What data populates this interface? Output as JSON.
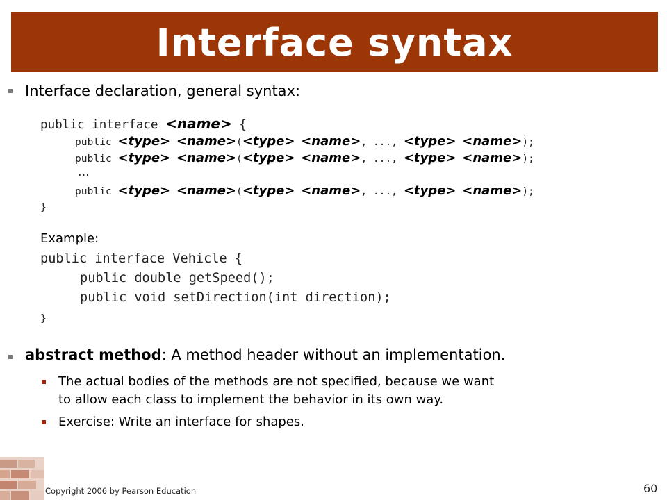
{
  "slide": {
    "title": "Interface syntax",
    "accent_color": "#9c3607",
    "bullet1": {
      "text": "Interface declaration, general syntax:"
    },
    "syntax": {
      "line1_pre": "public interface ",
      "line1_ph": "<name>",
      "line1_post": " {",
      "method_kw": "public ",
      "ph_type": "<type>",
      "ph_name": "<name>",
      "sep1": " ",
      "paren_open": "(",
      "sep2": ", ..., ",
      "paren_close": ");",
      "ellipsis": "...",
      "close": "}"
    },
    "example": {
      "label": "Example:",
      "line1": "public interface Vehicle {",
      "line2": "public double getSpeed();",
      "line3": "public void setDirection(int direction);",
      "line4": "}"
    },
    "bullet2": {
      "term": "abstract method",
      "text": ": A method header without an implementation."
    },
    "sub1": {
      "line1": "The actual bodies of the methods are not specified, because we want",
      "line2": "to allow each class to implement the behavior in its own way."
    },
    "sub2": {
      "text": "Exercise: Write an interface for shapes."
    },
    "footer": {
      "copyright": "Copyright 2006 by Pearson Education",
      "page_number": "60"
    }
  }
}
